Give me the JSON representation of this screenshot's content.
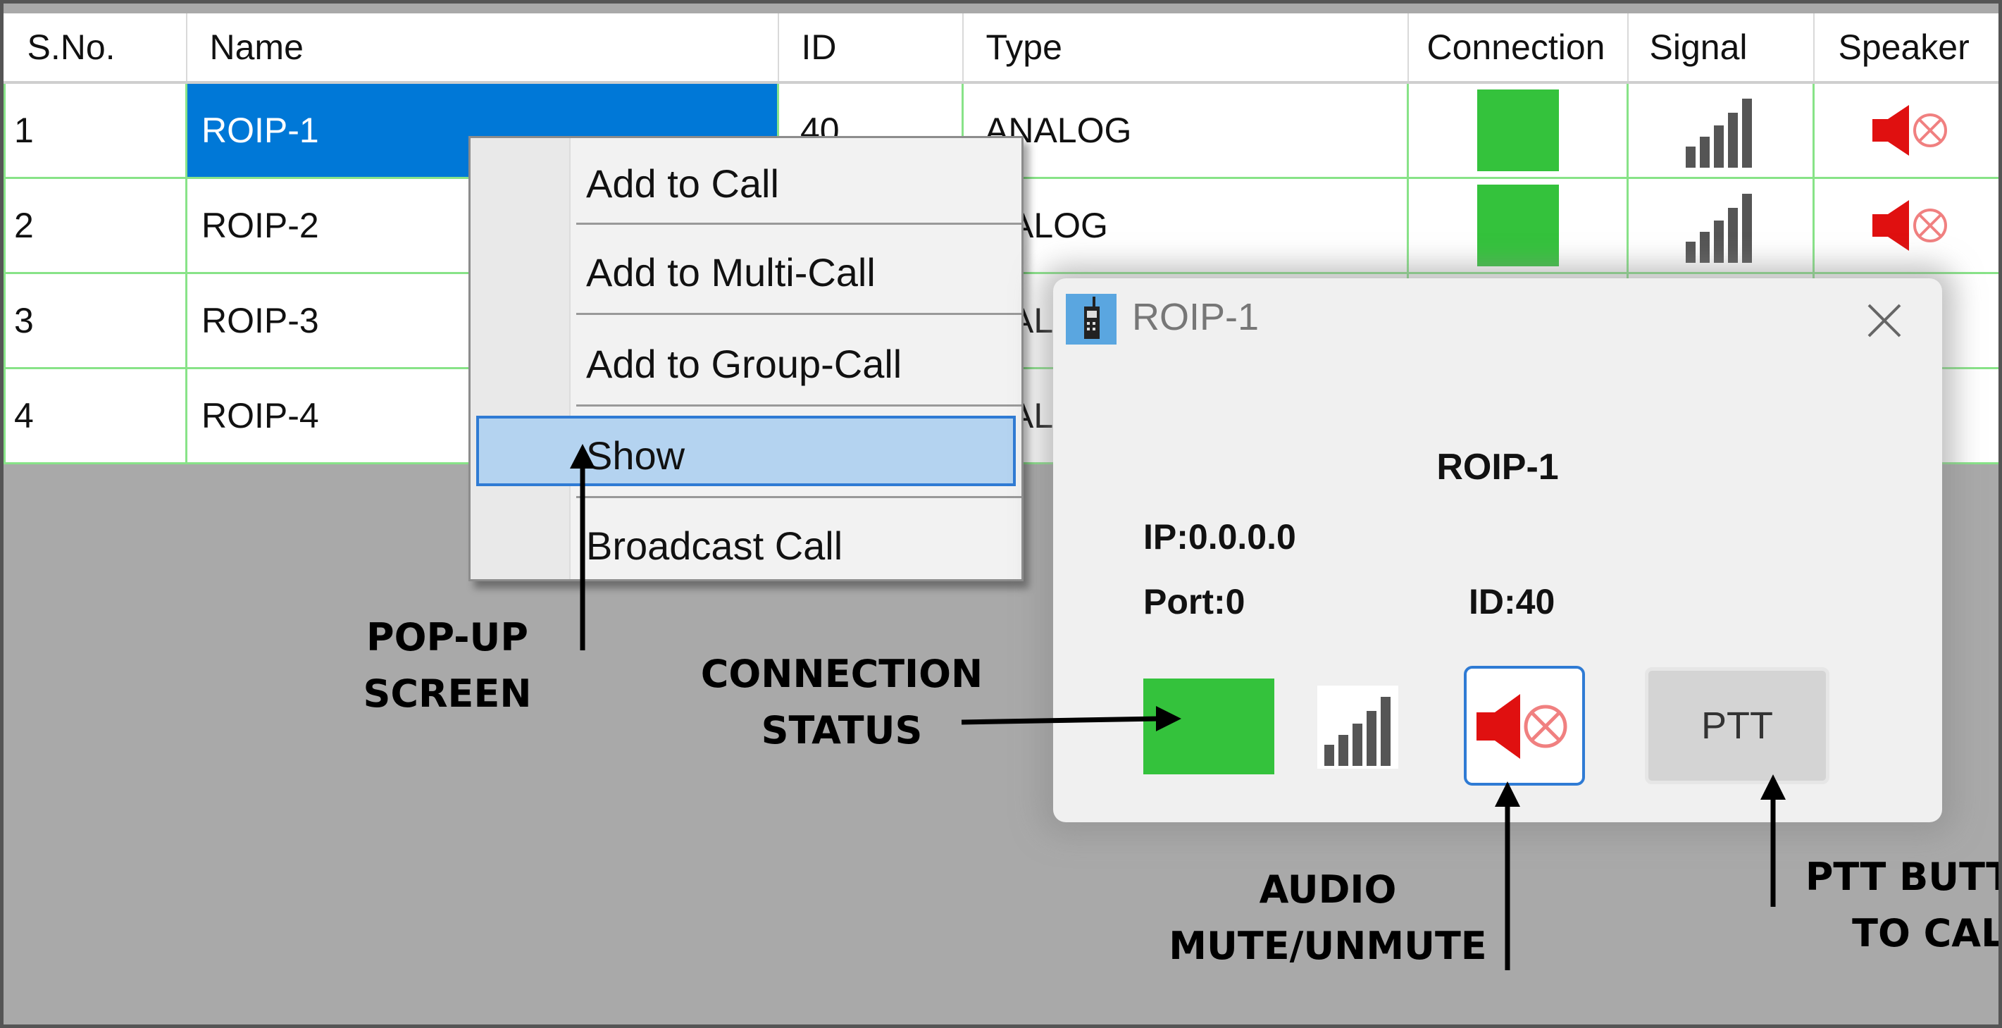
{
  "grid": {
    "columns": [
      "S.No.",
      "Name",
      "ID",
      "Type",
      "Connection",
      "Signal",
      "Speaker"
    ],
    "rows": [
      {
        "sno": "1",
        "name": "ROIP-1",
        "id": "40",
        "type": "ANALOG"
      },
      {
        "sno": "2",
        "name": "ROIP-2",
        "id": "",
        "type": "ANALOG"
      },
      {
        "sno": "3",
        "name": "ROIP-3",
        "id": "",
        "type": "ANALOG"
      },
      {
        "sno": "4",
        "name": "ROIP-4",
        "id": "",
        "type": "ANALOG"
      }
    ],
    "visible_text": {
      "row1_id": "40",
      "row1_type": "ANALOG",
      "row2_type": "ALOG",
      "row3_type": "AL",
      "row4_type": "AL"
    }
  },
  "context_menu": {
    "items": [
      "Add to Call",
      "Add to Multi-Call",
      "Add to Group-Call",
      "Show",
      "Broadcast Call"
    ],
    "highlighted": "Show"
  },
  "dialog": {
    "title": "ROIP-1",
    "name": "ROIP-1",
    "ip": "IP:0.0.0.0",
    "port": "Port:0",
    "id": "ID:40",
    "ptt_label": "PTT"
  },
  "annotations": {
    "popup_screen": [
      "POP-UP",
      "SCREEN"
    ],
    "connection_status": [
      "CONNECTION",
      "STATUS"
    ],
    "audio": [
      "AUDIO",
      "MUTE/UNMUTE"
    ],
    "ptt": [
      "PTT BUTTON",
      "TO CALL"
    ]
  },
  "colors": {
    "connected": "#34c23c",
    "selection": "#0078d7",
    "menu_highlight": "#b4d3f0",
    "speaker_muted": "#e01010"
  },
  "icons": {
    "signal": "signal-bars-icon",
    "speaker": "speaker-muted-icon",
    "close": "close-icon",
    "app": "radio-icon"
  }
}
